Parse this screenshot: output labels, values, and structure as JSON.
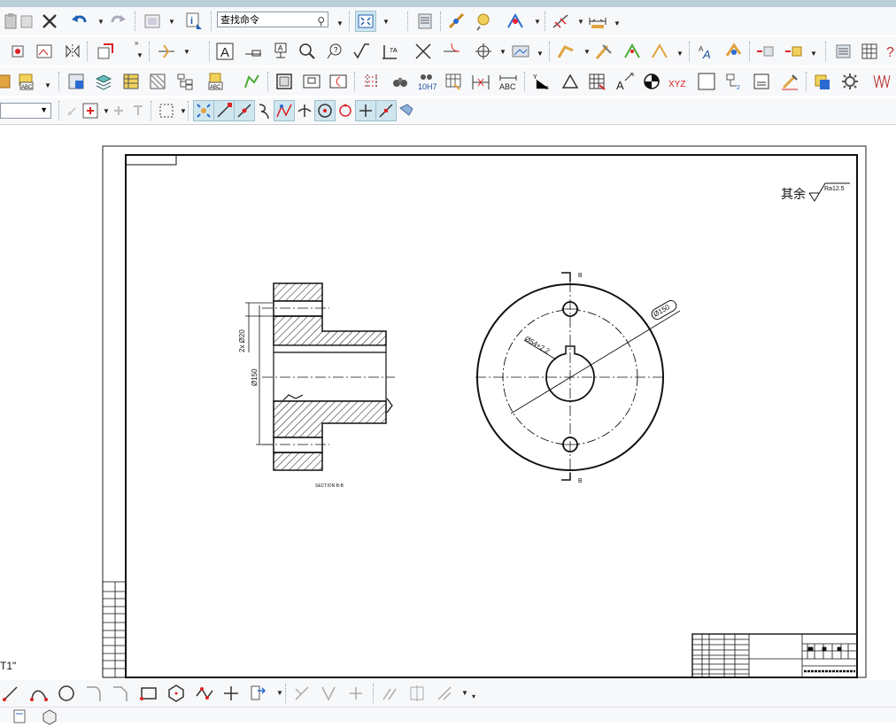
{
  "toolbar": {
    "command_search_value": "查找命令",
    "rows": [
      [
        "paste-icon",
        "delete-icon",
        "undo-icon",
        "redo-icon",
        "view-icon",
        "info-icon",
        "command-search",
        "zoom-fit-icon",
        "layer-icon",
        "measure-icon",
        "analysis-icon",
        "snap-icon",
        "dimension-icon",
        "ruler-icon"
      ],
      [
        "text-icon",
        "balloon-icon",
        "zoom-icon",
        "sketch-icon",
        "roughness-icon",
        "weld-icon",
        "cross-icon",
        "trim-icon",
        "center-icon",
        "hatch-icon",
        "bend-icon",
        "annotate-icon",
        "parts-icon",
        "style-icon"
      ],
      [
        "block-icon",
        "layer-manager-icon",
        "table-icon",
        "sheet-icon",
        "tree-icon",
        "abc-icon",
        "view-create-icon",
        "frame-icon",
        "detail-icon",
        "crosshatch-icon",
        "binoculars-icon",
        "tolerance-icon",
        "datum-icon",
        "abc-dim-icon",
        "ordinate-icon",
        "triangle-icon",
        "grid-icon",
        "leader-icon",
        "centroid-icon",
        "xyz-icon",
        "rect-icon",
        "surface-icon",
        "note-icon",
        "brush-icon",
        "gear-icon"
      ]
    ]
  },
  "snap_toolbar": {
    "layer_value": ""
  },
  "viewport": {
    "label": "T1\""
  },
  "drawing": {
    "surface_note": "其余",
    "surface_value": "Ra12.5",
    "section_label": "SECTION B-B",
    "cut_label_top": "B",
    "cut_label_bottom": "B",
    "dim_holes": "2x Ø20",
    "dim_bore": "Ø150",
    "dim_pcd": "Ø54+2.2",
    "dim_outer": "Ø150"
  }
}
